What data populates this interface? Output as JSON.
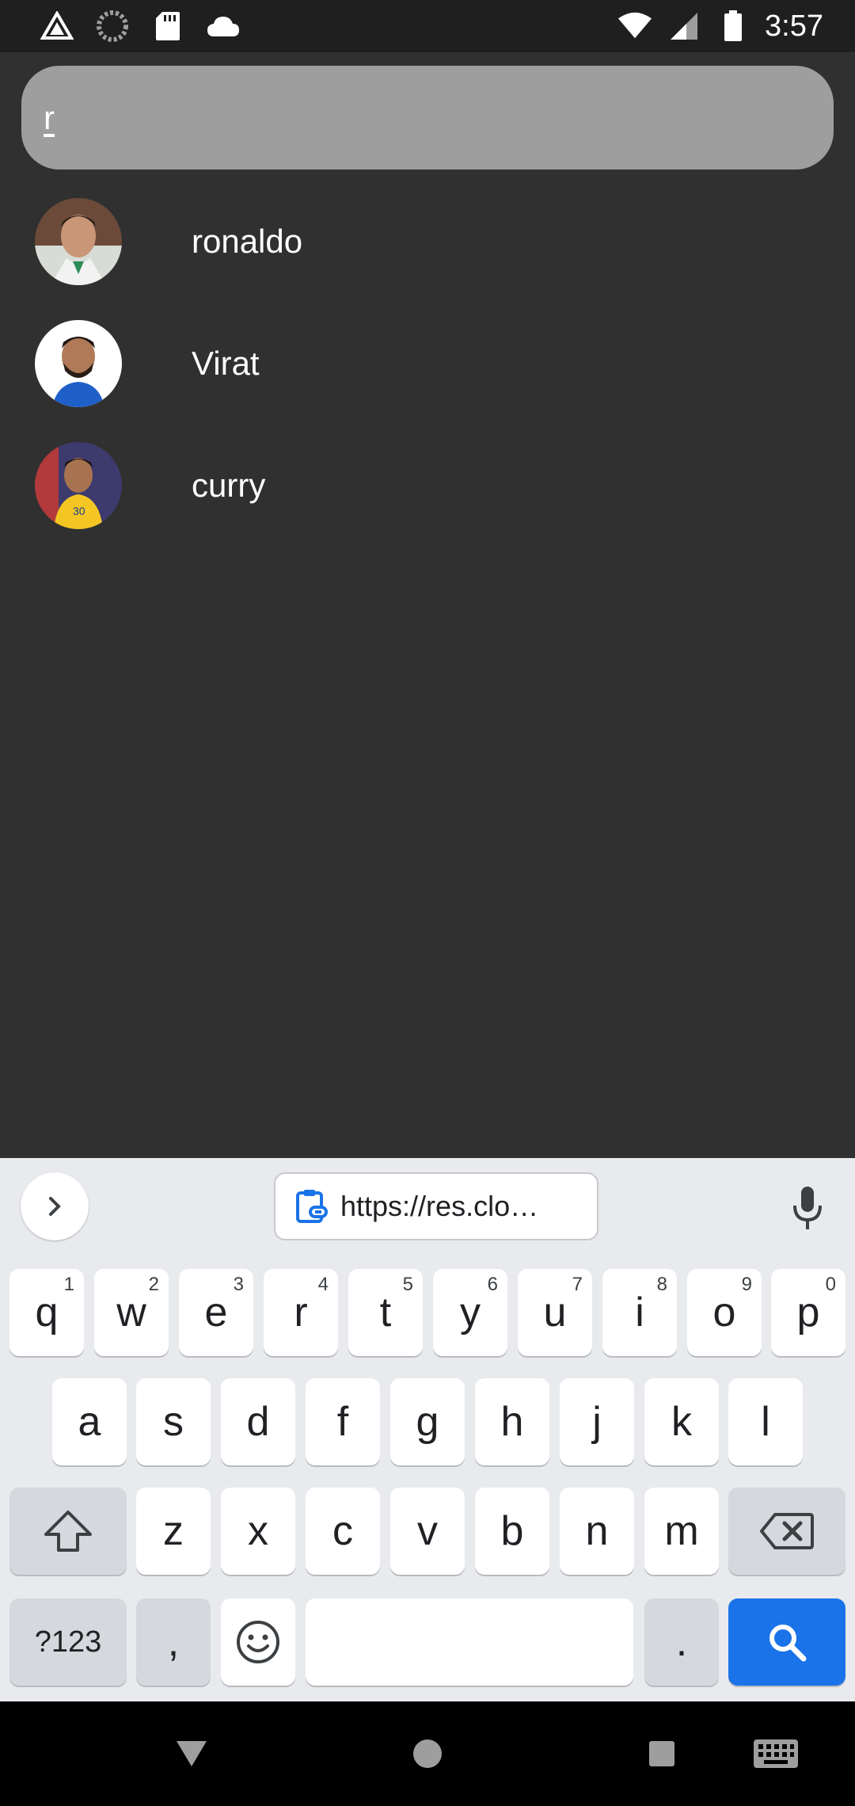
{
  "status_bar": {
    "time": "3:57",
    "icons_left": [
      "drive-icon",
      "sync-icon",
      "sd-card-icon",
      "cloud-icon"
    ],
    "icons_right": [
      "wifi-icon",
      "signal-icon",
      "battery-icon"
    ]
  },
  "search": {
    "value": "r"
  },
  "results": [
    {
      "name": "ronaldo",
      "avatar": "avatar-ronaldo"
    },
    {
      "name": "Virat",
      "avatar": "avatar-virat"
    },
    {
      "name": "curry",
      "avatar": "avatar-curry"
    }
  ],
  "keyboard": {
    "clipboard_text": "https://res.clo…",
    "row1": [
      {
        "key": "q",
        "sup": "1"
      },
      {
        "key": "w",
        "sup": "2"
      },
      {
        "key": "e",
        "sup": "3"
      },
      {
        "key": "r",
        "sup": "4"
      },
      {
        "key": "t",
        "sup": "5"
      },
      {
        "key": "y",
        "sup": "6"
      },
      {
        "key": "u",
        "sup": "7"
      },
      {
        "key": "i",
        "sup": "8"
      },
      {
        "key": "o",
        "sup": "9"
      },
      {
        "key": "p",
        "sup": "0"
      }
    ],
    "row2": [
      "a",
      "s",
      "d",
      "f",
      "g",
      "h",
      "j",
      "k",
      "l"
    ],
    "row3": [
      "z",
      "x",
      "c",
      "v",
      "b",
      "n",
      "m"
    ],
    "symbols_label": "?123",
    "comma_label": ",",
    "period_label": ".",
    "accent_color": "#1a73e8"
  },
  "colors": {
    "background": "#303030",
    "search_background": "#9e9e9e",
    "keyboard_background": "#e8eaed"
  }
}
